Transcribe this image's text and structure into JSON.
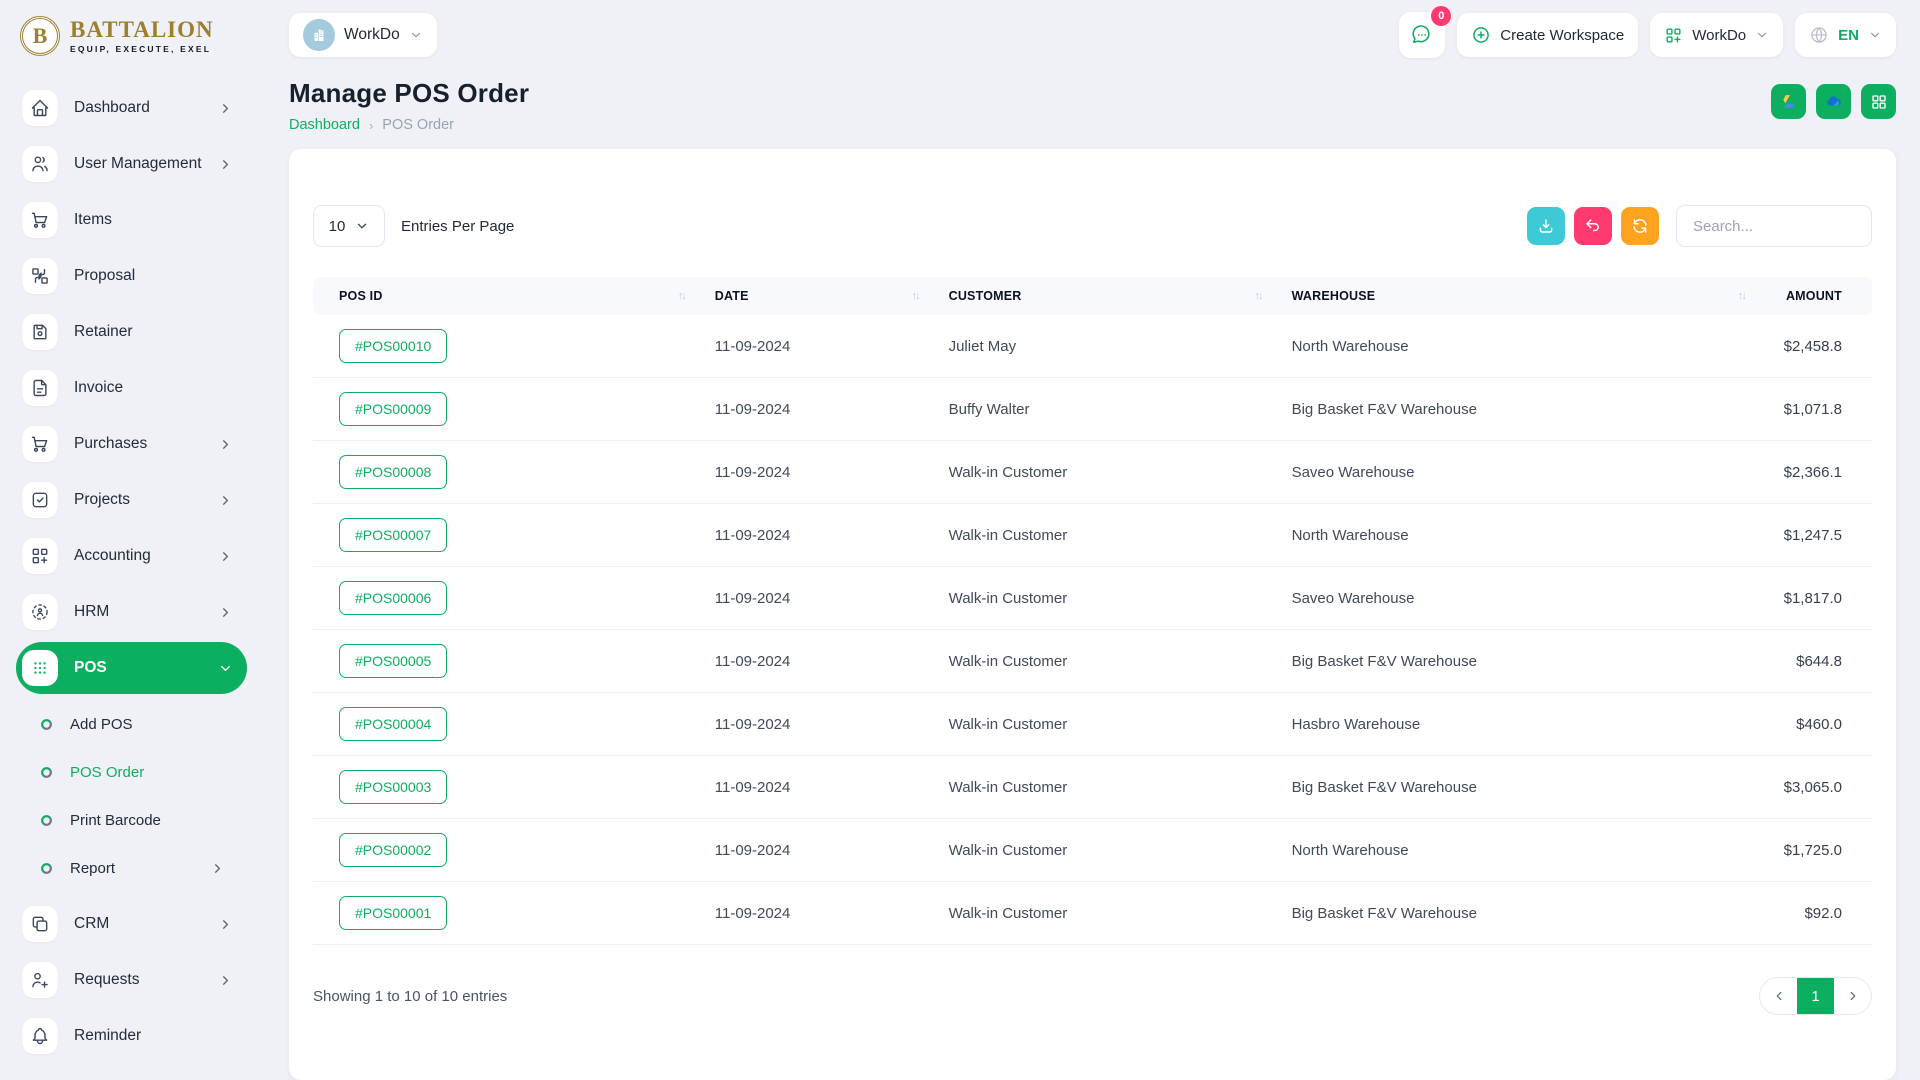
{
  "brand": {
    "name": "BATTALION",
    "tagline": "EQUIP, EXECUTE, EXEL",
    "emblem_letter": "B"
  },
  "topbar": {
    "workspace_selector": {
      "label": "WorkDo",
      "icon": "building-icon"
    },
    "messages_badge": "0",
    "create_workspace_label": "Create Workspace",
    "workdo_button_label": "WorkDo",
    "language": "EN"
  },
  "sidebar": {
    "items": [
      {
        "label": "Dashboard",
        "icon": "home-icon"
      },
      {
        "label": "User Management",
        "icon": "users-icon"
      },
      {
        "label": "Items",
        "icon": "cart-icon"
      },
      {
        "label": "Proposal",
        "icon": "transform-icon"
      },
      {
        "label": "Retainer",
        "icon": "floppy-icon"
      },
      {
        "label": "Invoice",
        "icon": "file-text-icon"
      },
      {
        "label": "Purchases",
        "icon": "cart-icon"
      },
      {
        "label": "Projects",
        "icon": "check-square-icon"
      },
      {
        "label": "Accounting",
        "icon": "grid-plus-icon"
      },
      {
        "label": "HRM",
        "icon": "person-dashed-circle-icon"
      },
      {
        "label": "POS",
        "icon": "dots-grid-icon",
        "active": true
      },
      {
        "label": "CRM",
        "icon": "copy-icon"
      },
      {
        "label": "Requests",
        "icon": "user-plus-icon"
      },
      {
        "label": "Reminder",
        "icon": "bell-icon"
      }
    ],
    "pos_submenu": [
      {
        "label": "Add POS"
      },
      {
        "label": "POS Order",
        "active": true
      },
      {
        "label": "Print Barcode"
      },
      {
        "label": "Report"
      }
    ]
  },
  "page": {
    "title": "Manage POS Order",
    "breadcrumb_home": "Dashboard",
    "breadcrumb_current": "POS Order"
  },
  "table_card": {
    "entries_per_page": "10",
    "entries_label": "Entries Per Page",
    "search_placeholder": "Search...",
    "columns": [
      "POS ID",
      "DATE",
      "CUSTOMER",
      "WAREHOUSE",
      "AMOUNT"
    ],
    "rows": [
      {
        "pos_id": "#POS00010",
        "date": "11-09-2024",
        "customer": "Juliet May",
        "warehouse": "North Warehouse",
        "amount": "$2,458.8"
      },
      {
        "pos_id": "#POS00009",
        "date": "11-09-2024",
        "customer": "Buffy Walter",
        "warehouse": "Big Basket F&V Warehouse",
        "amount": "$1,071.8"
      },
      {
        "pos_id": "#POS00008",
        "date": "11-09-2024",
        "customer": "Walk-in Customer",
        "warehouse": "Saveo Warehouse",
        "amount": "$2,366.1"
      },
      {
        "pos_id": "#POS00007",
        "date": "11-09-2024",
        "customer": "Walk-in Customer",
        "warehouse": "North Warehouse",
        "amount": "$1,247.5"
      },
      {
        "pos_id": "#POS00006",
        "date": "11-09-2024",
        "customer": "Walk-in Customer",
        "warehouse": "Saveo Warehouse",
        "amount": "$1,817.0"
      },
      {
        "pos_id": "#POS00005",
        "date": "11-09-2024",
        "customer": "Walk-in Customer",
        "warehouse": "Big Basket F&V Warehouse",
        "amount": "$644.8"
      },
      {
        "pos_id": "#POS00004",
        "date": "11-09-2024",
        "customer": "Walk-in Customer",
        "warehouse": "Hasbro Warehouse",
        "amount": "$460.0"
      },
      {
        "pos_id": "#POS00003",
        "date": "11-09-2024",
        "customer": "Walk-in Customer",
        "warehouse": "Big Basket F&V Warehouse",
        "amount": "$3,065.0"
      },
      {
        "pos_id": "#POS00002",
        "date": "11-09-2024",
        "customer": "Walk-in Customer",
        "warehouse": "North Warehouse",
        "amount": "$1,725.0"
      },
      {
        "pos_id": "#POS00001",
        "date": "11-09-2024",
        "customer": "Walk-in Customer",
        "warehouse": "Big Basket F&V Warehouse",
        "amount": "$92.0"
      }
    ],
    "footer": {
      "showing_text": "Showing 1 to 10 of 10 entries",
      "current_page": "1"
    }
  },
  "colors": {
    "primary_green": "#0caf60",
    "danger_pink": "#ff3a6e",
    "info_cyan": "#3ec9d6",
    "warning_orange": "#ffa21d",
    "brand_gold": "#9d7f30",
    "page_background": "#eff1f6"
  }
}
